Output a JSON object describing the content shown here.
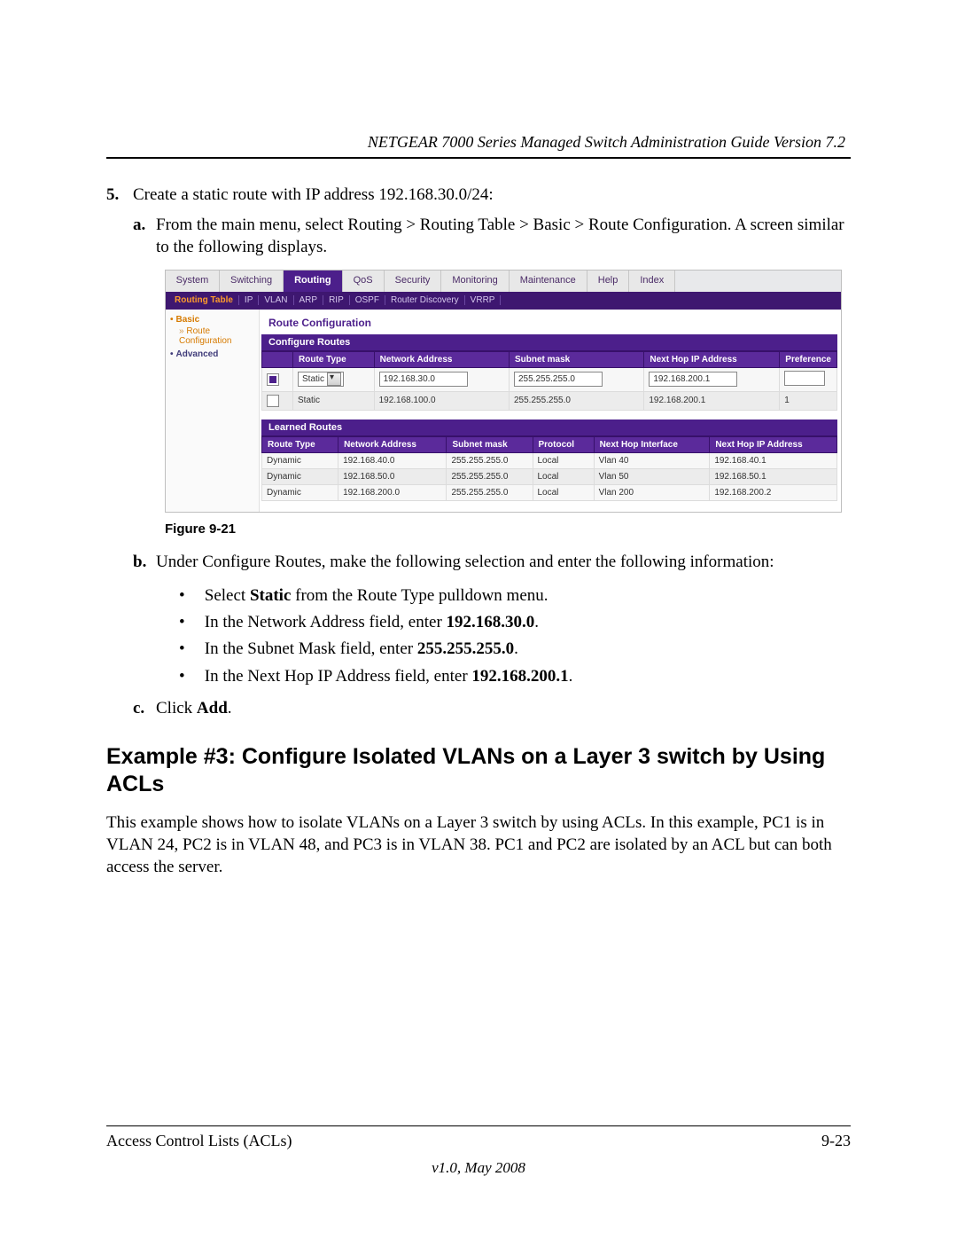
{
  "header": {
    "title": "NETGEAR 7000 Series Managed Switch Administration Guide Version 7.2"
  },
  "steps": {
    "five_marker": "5.",
    "five_text": "Create a static route with IP address 192.168.30.0/24:",
    "a_marker": "a.",
    "a_text": "From the main menu, select Routing > Routing Table > Basic > Route Configuration. A screen similar to the following displays.",
    "b_marker": "b.",
    "b_text": "Under Configure Routes, make the following selection and enter the following information:",
    "bullets": {
      "b1_prefix": "Select ",
      "b1_bold": "Static",
      "b1_suffix": " from the Route Type pulldown menu.",
      "b2_prefix": "In the Network Address field, enter ",
      "b2_bold": "192.168.30.0",
      "b2_suffix": ".",
      "b3_prefix": "In the Subnet Mask field, enter ",
      "b3_bold": "255.255.255.0",
      "b3_suffix": ".",
      "b4_prefix": "In the Next Hop IP Address field, enter ",
      "b4_bold": "192.168.200.1",
      "b4_suffix": "."
    },
    "c_marker": "c.",
    "c_prefix": "Click ",
    "c_bold": "Add",
    "c_suffix": "."
  },
  "figure_caption": "Figure 9-21",
  "ui": {
    "tabs": {
      "system": "System",
      "switching": "Switching",
      "routing": "Routing",
      "qos": "QoS",
      "security": "Security",
      "monitoring": "Monitoring",
      "maintenance": "Maintenance",
      "help": "Help",
      "index": "Index"
    },
    "subtabs": {
      "routing_table": "Routing Table",
      "ip": "IP",
      "vlan": "VLAN",
      "arp": "ARP",
      "rip": "RIP",
      "ospf": "OSPF",
      "router_discovery": "Router Discovery",
      "vrrp": "VRRP"
    },
    "sidebar": {
      "basic": "Basic",
      "route_config": "Route Configuration",
      "advanced": "Advanced"
    },
    "main_title": "Route Configuration",
    "configure_head": "Configure Routes",
    "cfg_headers": {
      "type": "Route Type",
      "addr": "Network Address",
      "mask": "Subnet mask",
      "nhop": "Next Hop IP Address",
      "pref": "Preference"
    },
    "cfg_rows": [
      {
        "checked": true,
        "type": "Static",
        "select": true,
        "addr": "192.168.30.0",
        "mask": "255.255.255.0",
        "nhop": "192.168.200.1",
        "pref": ""
      },
      {
        "checked": false,
        "type": "Static",
        "select": false,
        "addr": "192.168.100.0",
        "mask": "255.255.255.0",
        "nhop": "192.168.200.1",
        "pref": "1"
      }
    ],
    "learned_head": "Learned Routes",
    "learn_headers": {
      "type": "Route Type",
      "addr": "Network Address",
      "mask": "Subnet mask",
      "proto": "Protocol",
      "iface": "Next Hop Interface",
      "nhop": "Next Hop IP Address"
    },
    "learn_rows": [
      {
        "type": "Dynamic",
        "addr": "192.168.40.0",
        "mask": "255.255.255.0",
        "proto": "Local",
        "iface": "Vlan 40",
        "nhop": "192.168.40.1"
      },
      {
        "type": "Dynamic",
        "addr": "192.168.50.0",
        "mask": "255.255.255.0",
        "proto": "Local",
        "iface": "Vlan 50",
        "nhop": "192.168.50.1"
      },
      {
        "type": "Dynamic",
        "addr": "192.168.200.0",
        "mask": "255.255.255.0",
        "proto": "Local",
        "iface": "Vlan 200",
        "nhop": "192.168.200.2"
      }
    ]
  },
  "section": {
    "heading": "Example #3: Configure Isolated VLANs on a Layer 3 switch by Using ACLs",
    "para": "This example shows how to isolate VLANs on a Layer 3 switch by using ACLs. In this example, PC1 is in VLAN 24, PC2 is in VLAN 48, and PC3 is in VLAN 38. PC1 and PC2 are isolated by an ACL but can both access the server."
  },
  "footer": {
    "left": "Access Control Lists (ACLs)",
    "right": "9-23",
    "version": "v1.0, May 2008"
  }
}
